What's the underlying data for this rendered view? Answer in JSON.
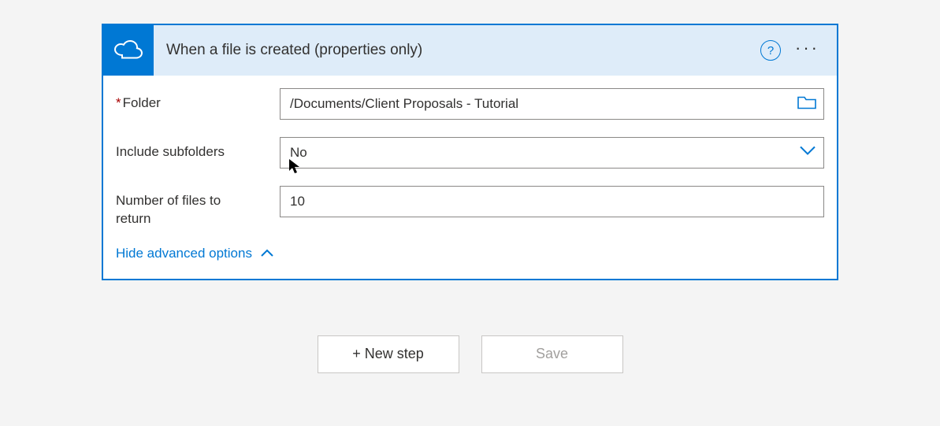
{
  "card": {
    "title": "When a file is created (properties only)",
    "help_glyph": "?",
    "more_glyph": "···"
  },
  "fields": {
    "folder": {
      "label": "Folder",
      "value": "/Documents/Client Proposals - Tutorial"
    },
    "include_subfolders": {
      "label": "Include subfolders",
      "value": "No"
    },
    "num_files": {
      "label": "Number of files to return",
      "value": "10"
    }
  },
  "advanced_toggle": "Hide advanced options",
  "buttons": {
    "new_step": "+ New step",
    "save": "Save"
  }
}
